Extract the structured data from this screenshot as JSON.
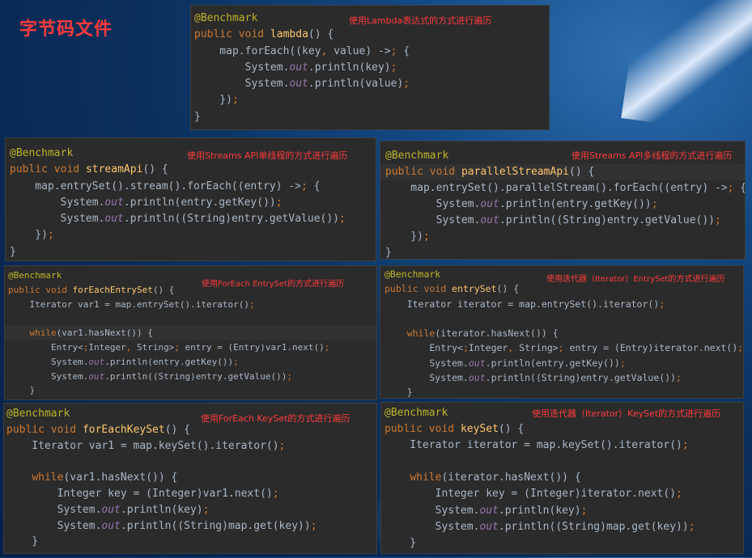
{
  "page_title": "字节码文件",
  "panels": [
    {
      "note": "使用Lambda表达式的方式进行遍历",
      "lines": [
        "@Benchmark",
        "public void lambda() {",
        "    map.forEach((key, value) -> {",
        "        System.out.println(key);",
        "        System.out.println(value);",
        "    });",
        "}"
      ]
    },
    {
      "note": "使用Streams API单线程的方式进行遍历",
      "lines": [
        "@Benchmark",
        "public void streamApi() {",
        "    map.entrySet().stream().forEach((entry) -> {",
        "        System.out.println(entry.getKey());",
        "        System.out.println((String)entry.getValue());",
        "    });",
        "}"
      ]
    },
    {
      "note": "使用Streams API多线程的方式进行遍历",
      "lines": [
        "@Benchmark",
        "public void parallelStreamApi() {",
        "    map.entrySet().parallelStream().forEach((entry) -> {",
        "        System.out.println(entry.getKey());",
        "        System.out.println((String)entry.getValue());",
        "    });",
        "}"
      ]
    },
    {
      "note": "使用ForEach EntrySet的方式进行遍历",
      "lines": [
        "@Benchmark",
        "public void forEachEntrySet() {",
        "    Iterator var1 = map.entrySet().iterator();",
        "",
        "    while(var1.hasNext()) {",
        "        Entry<Integer, String> entry = (Entry)var1.next();",
        "        System.out.println(entry.getKey());",
        "        System.out.println((String)entry.getValue());",
        "    }"
      ]
    },
    {
      "note": "使用迭代器（Iterator）EntrySet的方式进行遍历",
      "lines": [
        "@Benchmark",
        "public void entrySet() {",
        "    Iterator iterator = map.entrySet().iterator();",
        "",
        "    while(iterator.hasNext()) {",
        "        Entry<Integer, String> entry = (Entry)iterator.next();",
        "        System.out.println(entry.getKey());",
        "        System.out.println((String)entry.getValue());",
        "    }"
      ]
    },
    {
      "note": "使用ForEach KeySet的方式进行遍历",
      "lines": [
        "@Benchmark",
        "public void forEachKeySet() {",
        "    Iterator var1 = map.keySet().iterator();",
        "",
        "    while(var1.hasNext()) {",
        "        Integer key = (Integer)var1.next();",
        "        System.out.println(key);",
        "        System.out.println((String)map.get(key));",
        "    }"
      ]
    },
    {
      "note": "使用迭代器（Iterator）KeySet的方式进行遍历",
      "lines": [
        "@Benchmark",
        "public void keySet() {",
        "    Iterator iterator = map.keySet().iterator();",
        "",
        "    while(iterator.hasNext()) {",
        "        Integer key = (Integer)iterator.next();",
        "        System.out.println(key);",
        "        System.out.println((String)map.get(key));",
        "    }"
      ]
    }
  ]
}
